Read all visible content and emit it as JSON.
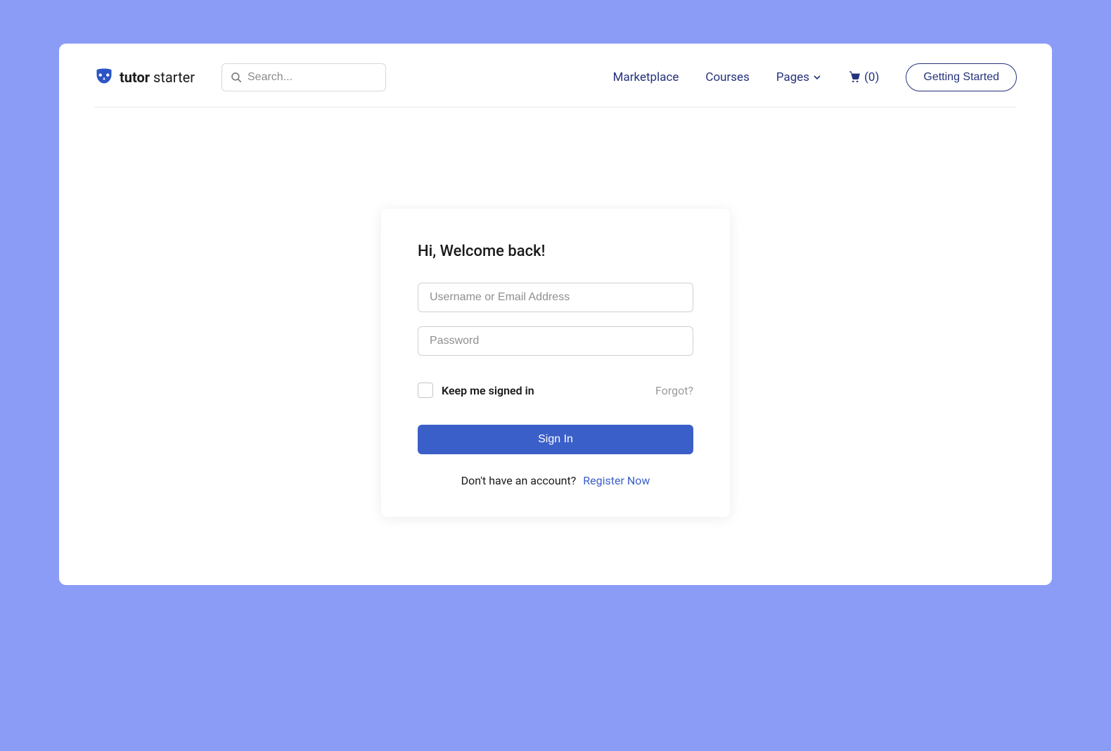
{
  "header": {
    "logo": {
      "brand_bold": "tutor",
      "brand_light": " starter",
      "icon": "owl-icon"
    },
    "search": {
      "placeholder": "Search..."
    },
    "nav": {
      "marketplace": "Marketplace",
      "courses": "Courses",
      "pages": "Pages"
    },
    "cart": {
      "count_display": "(0)",
      "count": 0
    },
    "cta": {
      "getting_started": "Getting Started"
    }
  },
  "login": {
    "title": "Hi, Welcome back!",
    "username_placeholder": "Username or Email Address",
    "password_placeholder": "Password",
    "remember_label": "Keep me signed in",
    "forgot_label": "Forgot?",
    "submit_label": "Sign In",
    "no_account_text": "Don't have an account?",
    "register_label": "Register Now"
  },
  "colors": {
    "page_bg": "#8b9cf7",
    "brand_blue": "#2b55c6",
    "nav_text": "#25327c",
    "primary_button": "#3b5fc9"
  }
}
